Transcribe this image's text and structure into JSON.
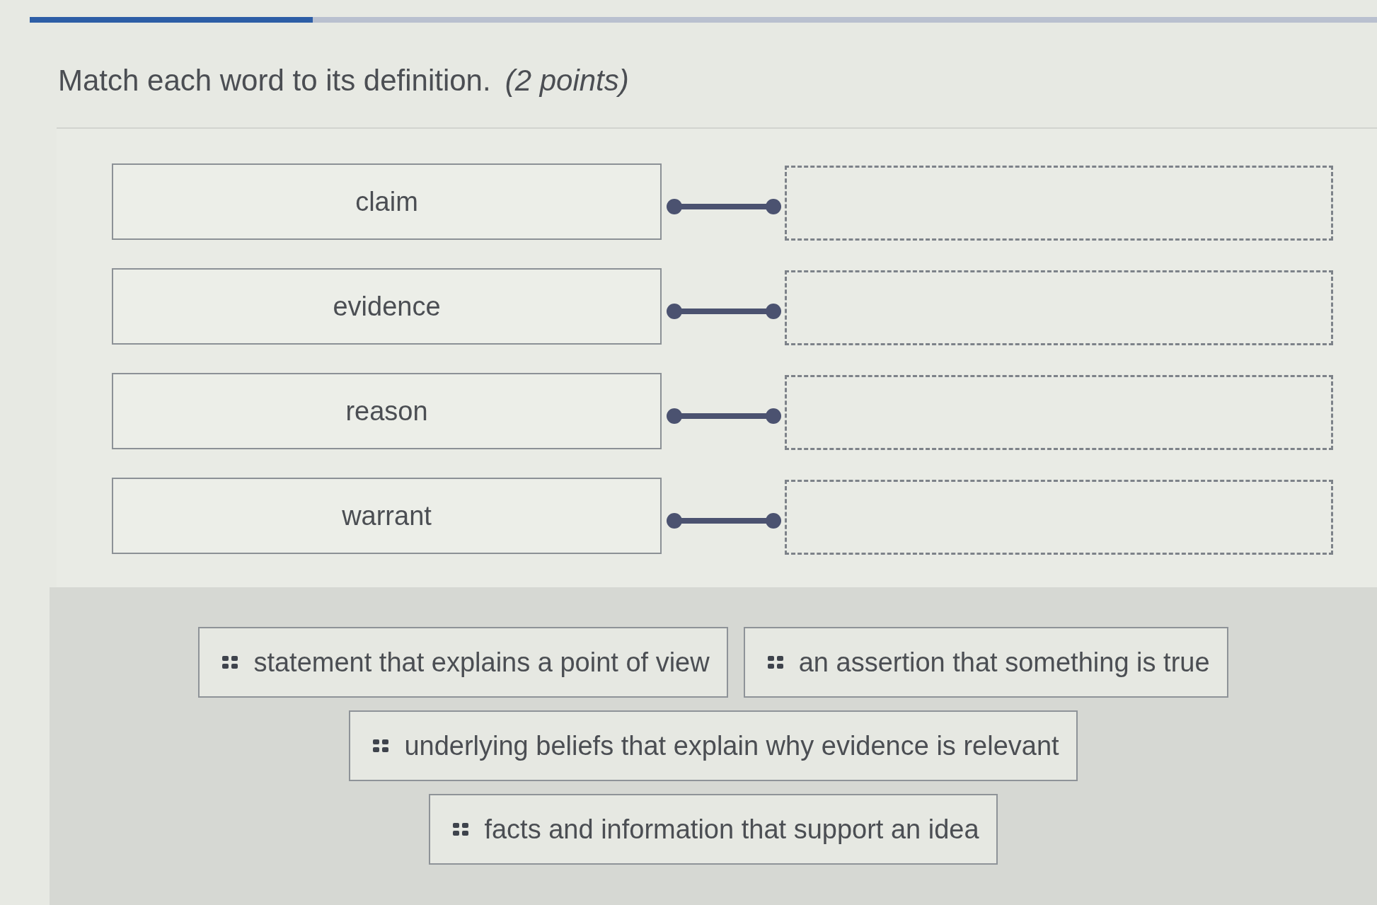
{
  "progress": {
    "level": 0.21
  },
  "question": {
    "text": "Match each word to its definition.",
    "points": "(2 points)"
  },
  "terms": [
    {
      "label": "claim"
    },
    {
      "label": "evidence"
    },
    {
      "label": "reason"
    },
    {
      "label": "warrant"
    }
  ],
  "answer_bank": {
    "rows": [
      [
        "statement that explains a point of view",
        "an assertion that something is true"
      ],
      [
        "underlying beliefs that explain why evidence is relevant"
      ],
      [
        "facts and information that support an idea"
      ]
    ]
  }
}
